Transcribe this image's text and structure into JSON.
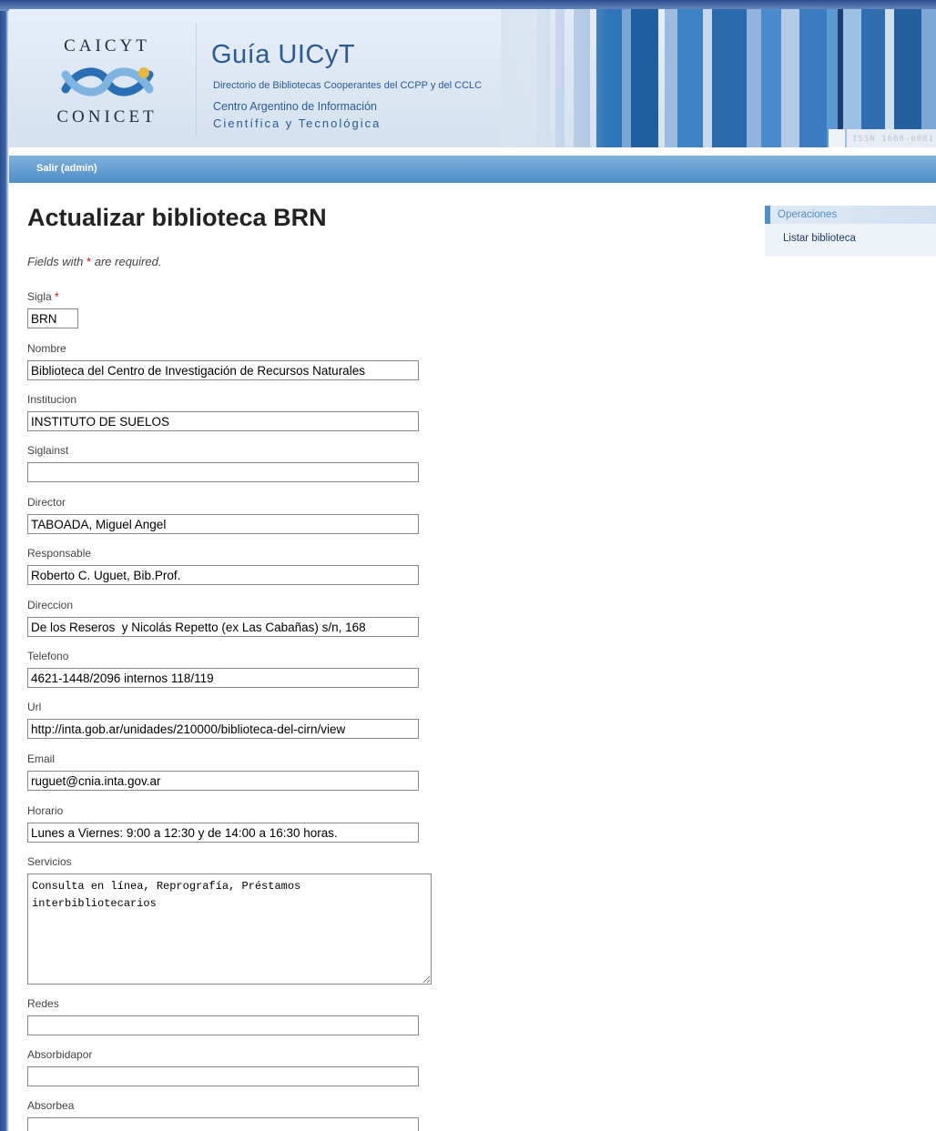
{
  "header": {
    "logo_top": "CAICYT",
    "logo_bottom": "CONICET",
    "site_title": "Guía UICyT",
    "site_subtitle": "Directorio de Bibliotecas Cooperantes del CCPP y del CCLC",
    "org_line1": "Centro Argentino de Información",
    "org_line2": "Científica y Tecnológica",
    "issn": "ISSN 1668-0081",
    "colors": {
      "brand_blue": "#2a5a98",
      "nav_blue": "#4f8ec9"
    }
  },
  "nav": {
    "logout_label": "Salir (admin)"
  },
  "main": {
    "title": "Actualizar biblioteca BRN",
    "required_note_pre": "Fields with",
    "required_star": "*",
    "required_note_post": "are required."
  },
  "form": {
    "sigla": {
      "label": "Sigla",
      "value": "BRN"
    },
    "nombre": {
      "label": "Nombre",
      "value": "Biblioteca del Centro de Investigación de Recursos Naturales"
    },
    "institucion": {
      "label": "Institucion",
      "value": "INSTITUTO DE SUELOS"
    },
    "siglainst": {
      "label": "Siglainst",
      "value": ""
    },
    "director": {
      "label": "Director",
      "value": "TABOADA, Miguel Angel"
    },
    "responsable": {
      "label": "Responsable",
      "value": "Roberto C. Uguet, Bib.Prof."
    },
    "direccion": {
      "label": "Direccion",
      "value": "De los Reseros  y Nicolás Repetto (ex Las Cabañas) s/n, 168"
    },
    "telefono": {
      "label": "Telefono",
      "value": "4621-1448/2096 internos 118/119"
    },
    "url": {
      "label": "Url",
      "value": "http://inta.gob.ar/unidades/210000/biblioteca-del-cirn/view"
    },
    "email": {
      "label": "Email",
      "value": "ruguet@cnia.inta.gov.ar"
    },
    "horario": {
      "label": "Horario",
      "value": "Lunes a Viernes: 9:00 a 12:30 y de 14:00 a 16:30 horas."
    },
    "servicios": {
      "label": "Servicios",
      "value": "Consulta en línea, Reprografía, Préstamos interbibliotecarios"
    },
    "redes": {
      "label": "Redes",
      "value": ""
    },
    "absorbidapor": {
      "label": "Absorbidapor",
      "value": ""
    },
    "absorbea": {
      "label": "Absorbea",
      "value": ""
    }
  },
  "sidebar": {
    "header": "Operaciones",
    "items": [
      {
        "label": "Listar biblioteca"
      }
    ]
  }
}
